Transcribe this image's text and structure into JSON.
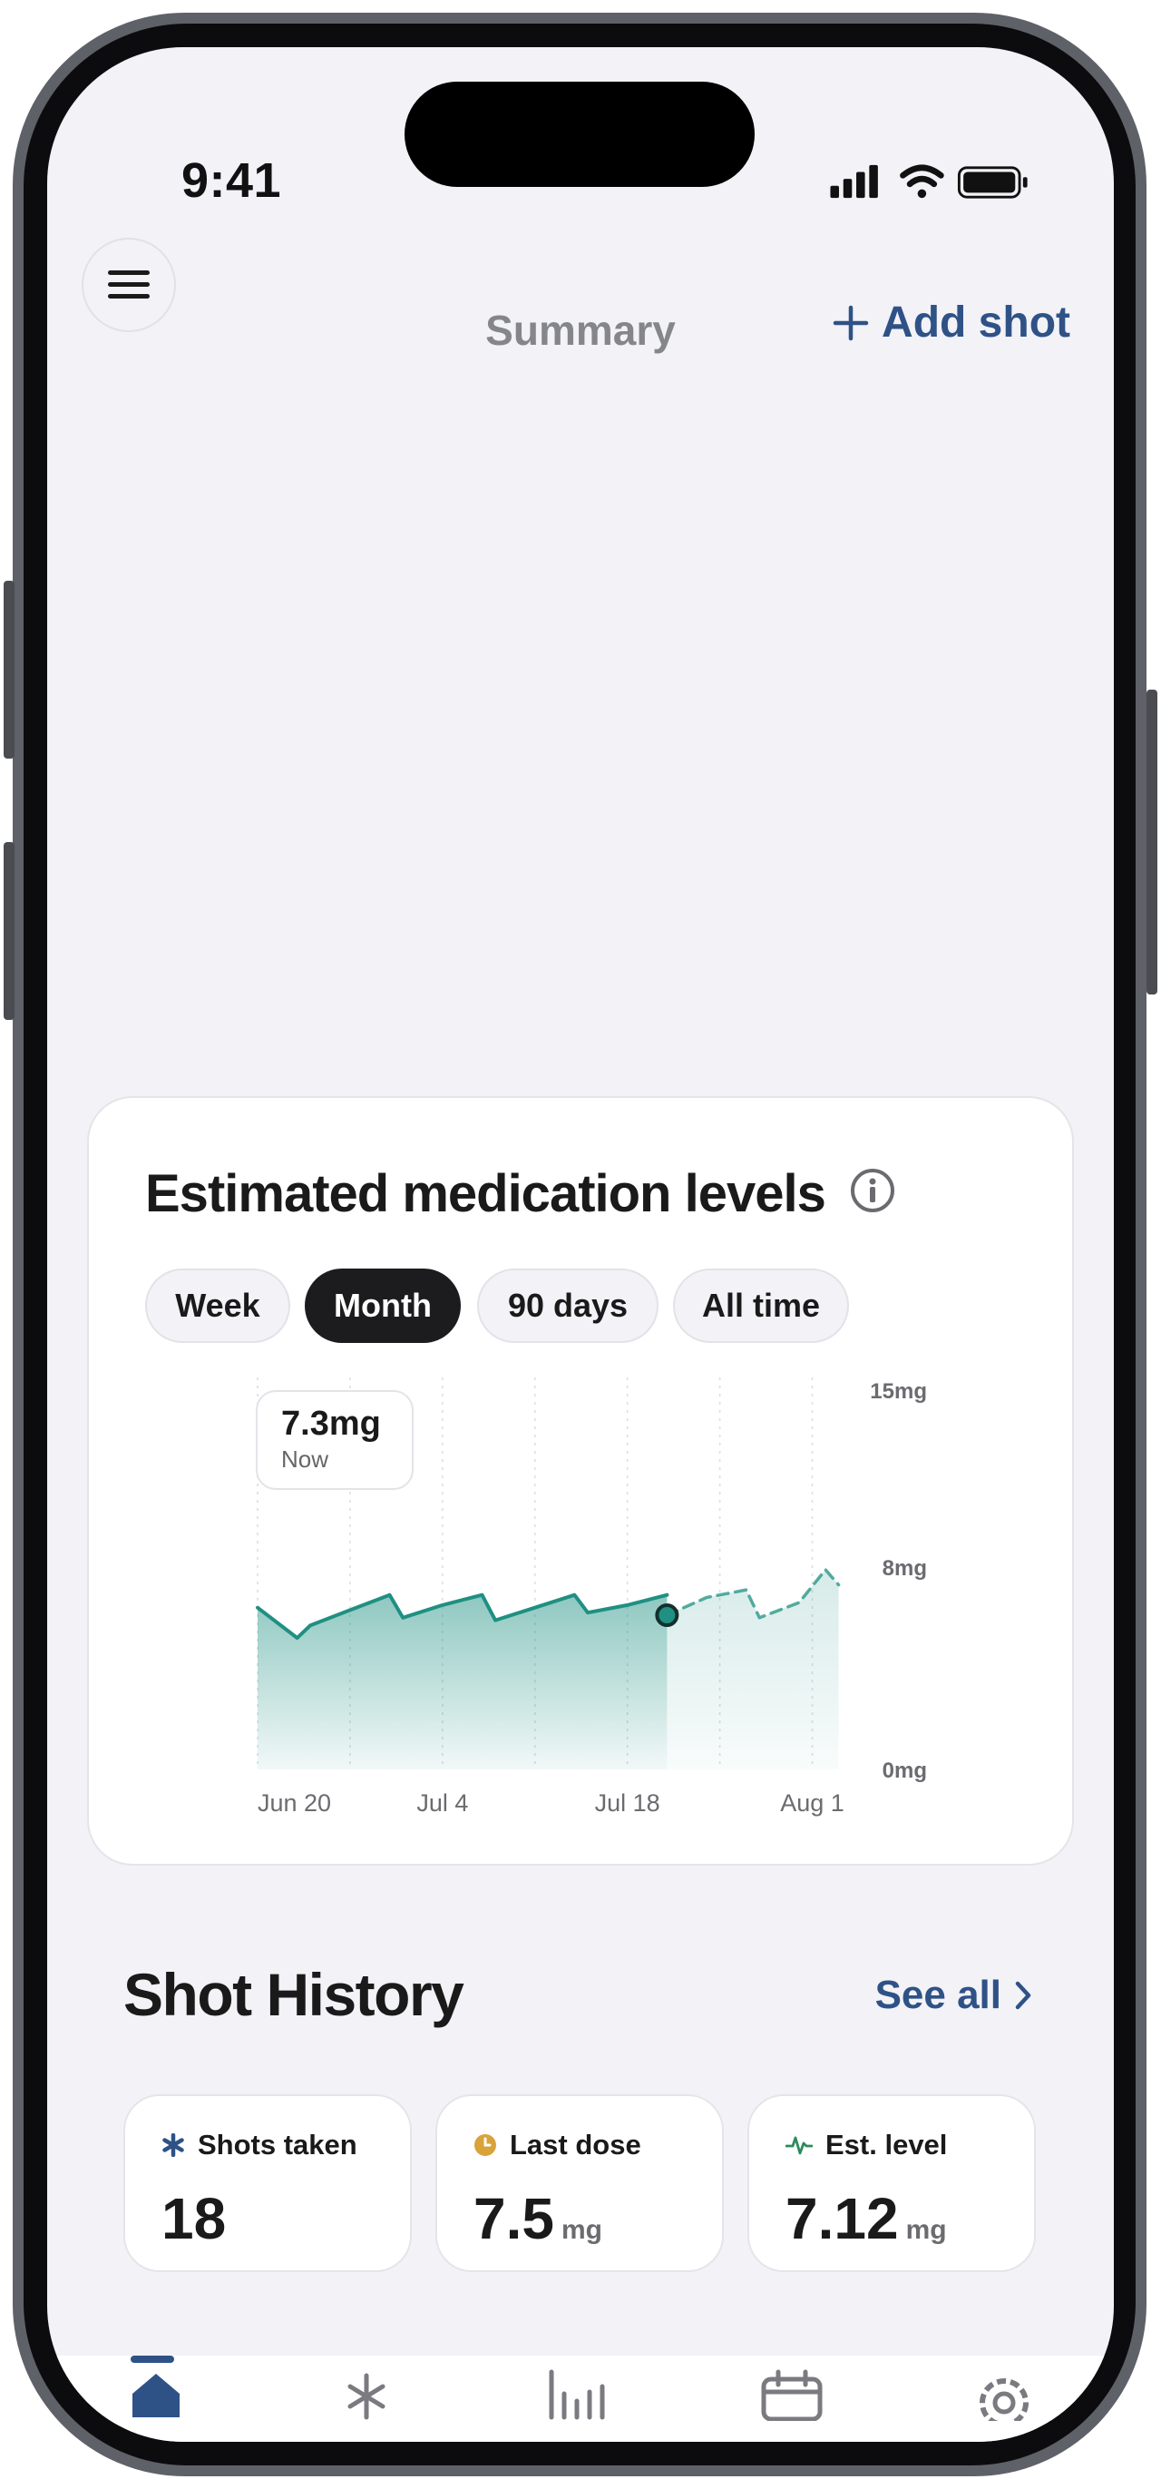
{
  "status_bar": {
    "time": "9:41"
  },
  "header": {
    "title": "Summary",
    "add_label": "Add shot"
  },
  "levels_card": {
    "title": "Estimated medication levels",
    "segments": [
      "Week",
      "Month",
      "90 days",
      "All time"
    ],
    "selected_segment": "Month",
    "tooltip": {
      "value": "7.3mg",
      "label": "Now"
    }
  },
  "chart_data": {
    "type": "area",
    "title": "",
    "x_ticks": [
      "Jun 20",
      "Jul 4",
      "Jul 18",
      "Aug 1"
    ],
    "y_ticks": [
      "15mg",
      "8mg",
      "0mg"
    ],
    "ylim": [
      0,
      15
    ],
    "grid": "vertical dotted",
    "series": [
      {
        "name": "",
        "style": "solid",
        "x_days": [
          0,
          3,
          4,
          7,
          10,
          11,
          14,
          17,
          18,
          21,
          24,
          25,
          28,
          31
        ],
        "values": [
          6.4,
          5.2,
          5.7,
          6.3,
          6.9,
          6.0,
          6.5,
          6.9,
          5.9,
          6.4,
          6.9,
          6.2,
          6.5,
          6.9
        ],
        "area_fill": true
      },
      {
        "name": "",
        "style": "dashed",
        "x_days": [
          31,
          34,
          37,
          38,
          41,
          43,
          44
        ],
        "values": [
          6.1,
          6.8,
          7.1,
          6.0,
          6.6,
          7.9,
          7.3
        ],
        "area_fill": true
      }
    ],
    "current_point": {
      "x_day": 31,
      "value": 6.1
    },
    "x_start_label": "Jun 20",
    "color": "#1f9082"
  },
  "history": {
    "title": "Shot History",
    "see_all": "See all",
    "stats": [
      {
        "label": "Shots taken",
        "value": "18",
        "unit": "",
        "icon": "asterisk-icon",
        "color": "#2f5286"
      },
      {
        "label": "Last dose",
        "value": "7.5",
        "unit": "mg",
        "icon": "clock-icon",
        "color": "#d9a33a"
      },
      {
        "label": "Est. level",
        "value": "7.12",
        "unit": "mg",
        "icon": "pulse-icon",
        "color": "#2d8a5c"
      }
    ]
  },
  "tabbar": {
    "tabs": [
      {
        "icon": "home-icon",
        "active": true
      },
      {
        "icon": "injection-icon",
        "active": false
      },
      {
        "icon": "chart-icon",
        "active": false
      },
      {
        "icon": "calendar-icon",
        "active": false
      },
      {
        "icon": "settings-icon",
        "active": false
      }
    ]
  }
}
